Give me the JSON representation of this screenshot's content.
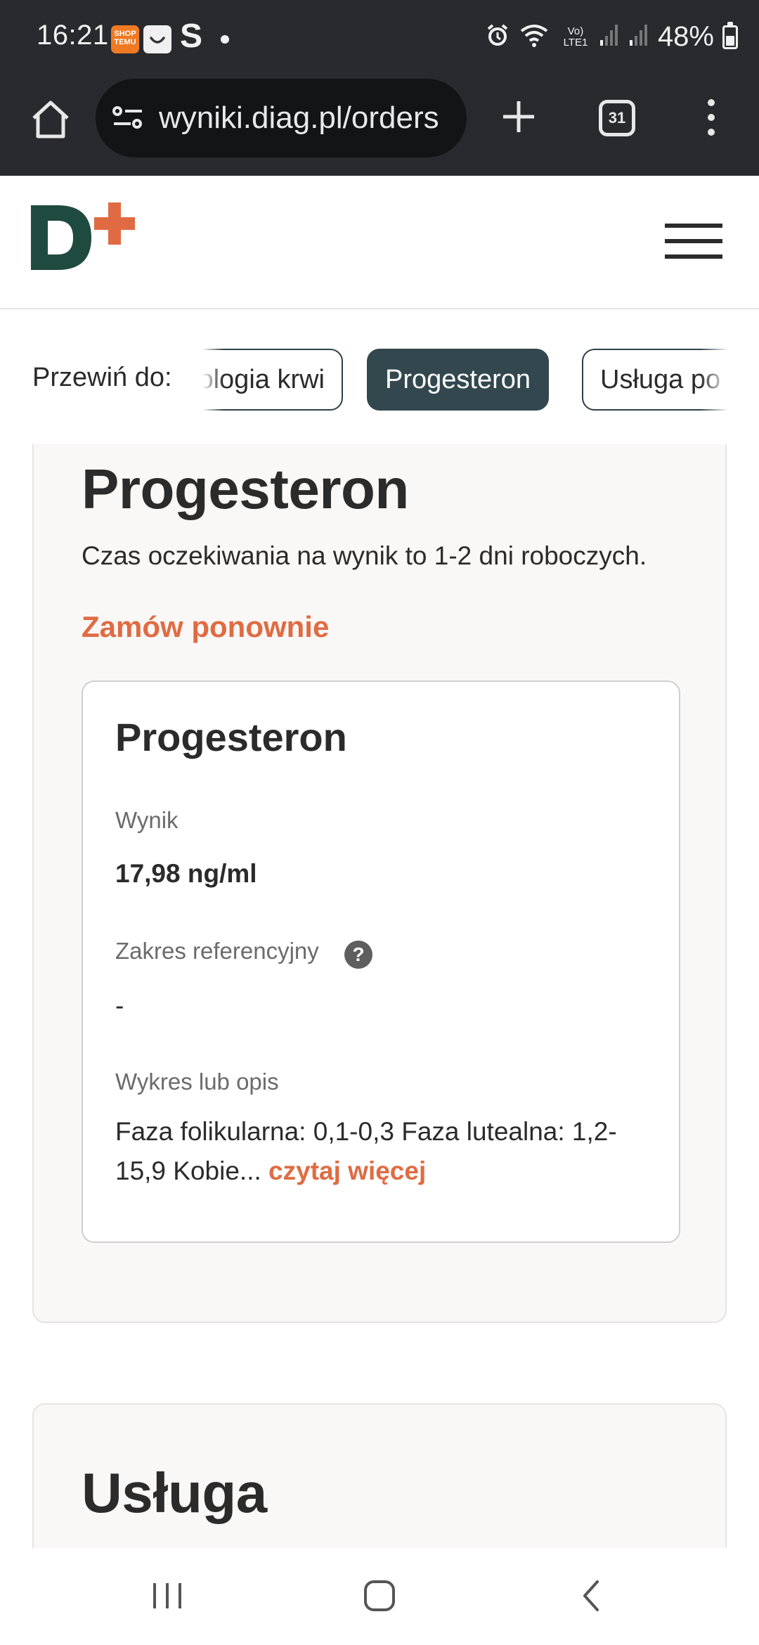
{
  "status_bar": {
    "time": "16:21",
    "temu_label": "SHOP TEMU",
    "s_label": "S",
    "battery": "48%",
    "battery_level": 0.48,
    "network_label": "Vo) LTE1"
  },
  "browser": {
    "url": "wyniki.diag.pl/orders",
    "tab_count": "31"
  },
  "site": {
    "logo_letter": "D",
    "brand_colors": {
      "dark_green": "#1f4a40",
      "accent_orange": "#e06b43",
      "chip_active": "#33484e"
    }
  },
  "scroll_to": {
    "label": "Przewiń do:",
    "chips": [
      {
        "label": "Morfologia krwi",
        "visible_text": "ologia krwi",
        "active": false
      },
      {
        "label": "Progesteron",
        "active": true
      },
      {
        "label": "Usługa po",
        "active": false
      }
    ]
  },
  "test_card": {
    "title": "Progesteron",
    "wait_text": "Czas oczekiwania na wynik to 1-2 dni roboczych.",
    "reorder_label": "Zamów ponownie",
    "result": {
      "name": "Progesteron",
      "result_label": "Wynik",
      "result_value": "17,98 ng/ml",
      "reference_label": "Zakres referencyjny",
      "reference_value": "-",
      "description_label": "Wykres lub opis",
      "description_text": "Faza folikularna: 0,1-0,3 Faza lutealna: 1,2-15,9 Kobie...",
      "read_more_label": "czytaj więcej"
    }
  },
  "service_card": {
    "title": "Usługa"
  },
  "icons": {
    "home": "home-icon",
    "site_settings": "tune-icon",
    "new_tab": "plus-icon",
    "tabs": "tabs-icon",
    "browser_menu": "more-vert-icon",
    "site_menu": "hamburger-icon",
    "help": "question-icon",
    "nav_recents": "recents-icon",
    "nav_home": "nav-home-icon",
    "nav_back": "back-icon"
  }
}
